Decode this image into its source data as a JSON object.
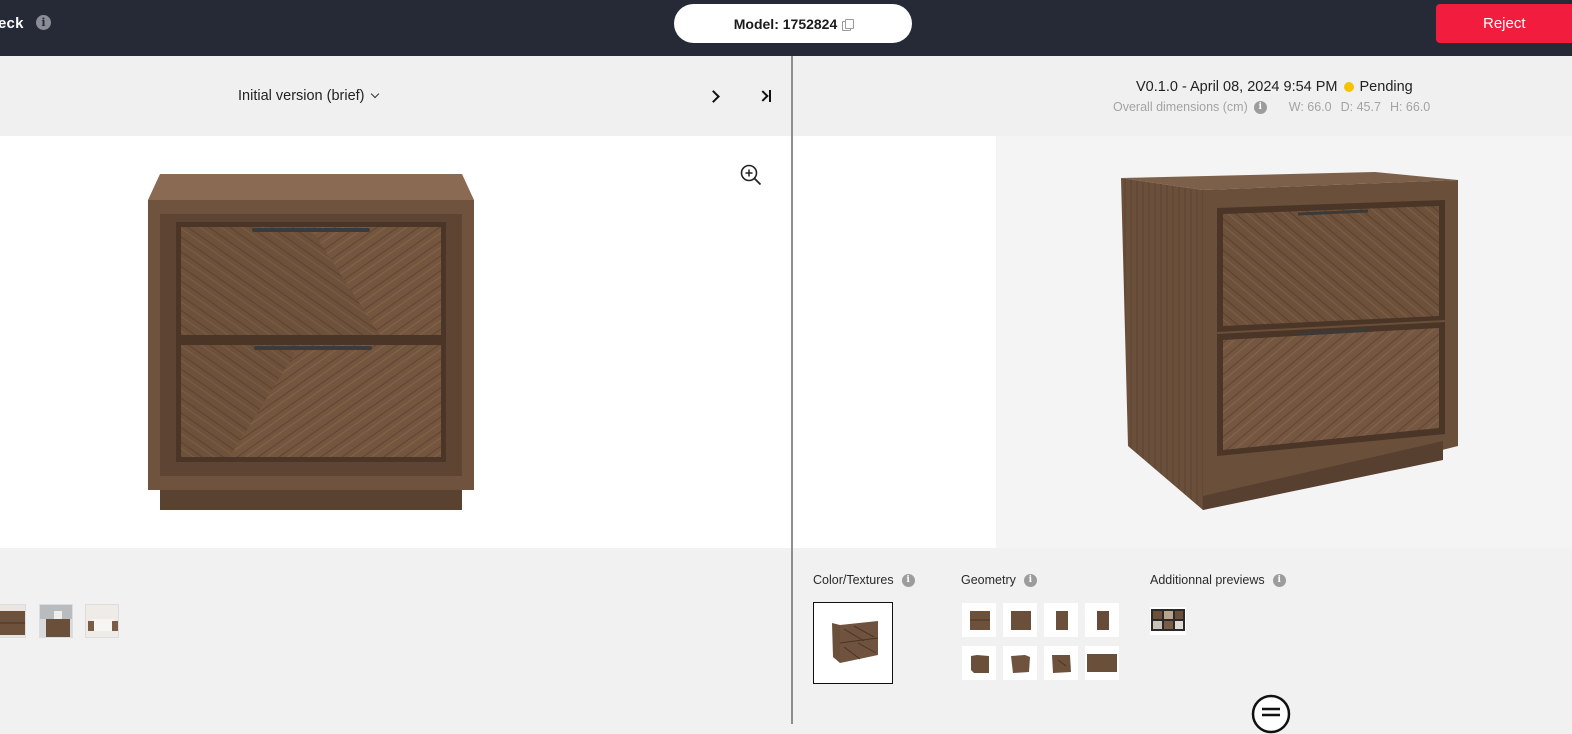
{
  "header": {
    "title_fragment": "eck",
    "title_info_icon": "info-icon",
    "model_label": "Model: 1752824",
    "copy_icon": "copy-icon",
    "reject_label": "Reject",
    "reject_color": "#f21d3e",
    "bar_color": "#262a37"
  },
  "left": {
    "version_select": "Initial version (brief)",
    "next_icon": "chevron-right-icon",
    "last_icon": "skip-to-last-icon",
    "zoom_icon": "zoom-in-icon",
    "thumbnails": [
      "nightstand-photo-front",
      "nightstand-lifestyle-photo",
      "bedroom-lifestyle-photo"
    ]
  },
  "right": {
    "version_text": "V0.1.0 - April 08, 2024 9:54 PM",
    "status_text": "Pending",
    "status_color": "#f5c400",
    "dims_label": "Overall dimensions (cm)",
    "dims": {
      "w": "W: 66.0",
      "d": "D: 45.7",
      "h": "H: 66.0"
    },
    "sections": {
      "color_textures": "Color/Textures",
      "geometry": "Geometry",
      "additional_previews": "Additionnal previews"
    },
    "geometry_thumbnail_count": 8,
    "chat_icon": "chat-icon"
  }
}
